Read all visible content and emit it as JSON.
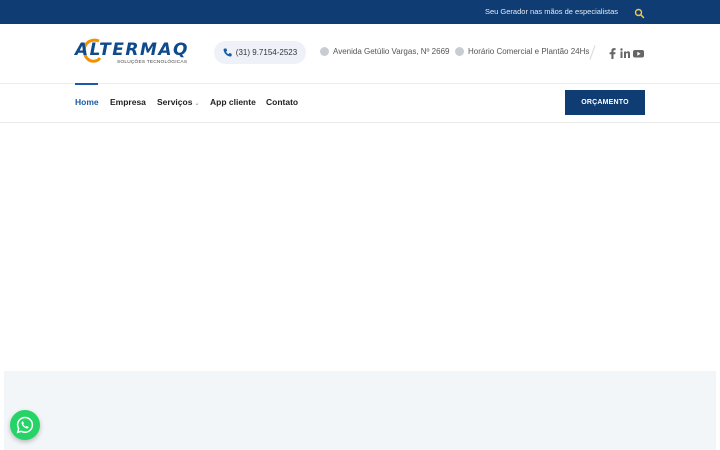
{
  "topbar": {
    "tagline": "Seu Gerador nas mãos de especialistas",
    "search_icon": "search-icon",
    "search_color": "#f2c94c"
  },
  "header": {
    "logo": {
      "text": "ALTERMAQ",
      "tagline": "SOLUÇÕES TECNOLÓGICAS"
    },
    "phone": "(31) 9.7154-2523",
    "address": "Avenida Getúlio Vargas, Nº 2669",
    "hours": "Horário Comercial e Plantão 24Hs",
    "social": [
      "facebook-icon",
      "linkedin-icon",
      "youtube-icon"
    ]
  },
  "nav": {
    "items": [
      {
        "label": "Home",
        "active": true
      },
      {
        "label": "Empresa"
      },
      {
        "label": "Serviços",
        "has_dropdown": true
      },
      {
        "label": "App cliente"
      },
      {
        "label": "Contato"
      }
    ],
    "cta_label": "ORÇAMENTO"
  },
  "widgets": {
    "whatsapp_icon": "whatsapp-icon"
  },
  "colors": {
    "brand_navy": "#0e3c73",
    "brand_blue": "#1a5ba6",
    "brand_orange": "#f29200",
    "whatsapp_green": "#25d366"
  }
}
